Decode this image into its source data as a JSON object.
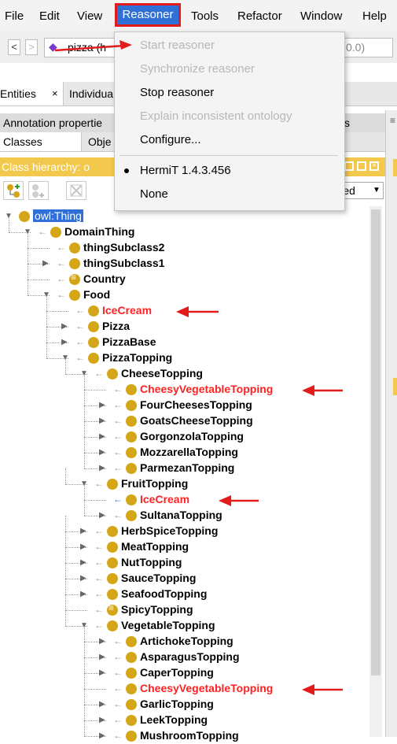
{
  "menubar": {
    "items": [
      "File",
      "Edit",
      "View",
      "Reasoner",
      "Tools",
      "Refactor",
      "Window",
      "Help"
    ]
  },
  "toolbar": {
    "back": "<",
    "forward": ">",
    "address_text": "pizza (h",
    "address_tail": "0.0)"
  },
  "tabs": {
    "row1": [
      "Entities",
      "Individua"
    ],
    "row1_close": "×",
    "row2": [
      "Annotation propertie",
      "s"
    ],
    "row3": [
      "Classes",
      "Obje"
    ]
  },
  "hierarchy": {
    "title": "Class hierarchy: o",
    "sort_label": "erted"
  },
  "reasoner_menu": {
    "items": [
      {
        "label": "Start reasoner",
        "enabled": false
      },
      {
        "label": "Synchronize reasoner",
        "enabled": false
      },
      {
        "label": "Stop reasoner",
        "enabled": true
      },
      {
        "label": "Explain inconsistent ontology",
        "enabled": false
      },
      {
        "label": "Configure...",
        "enabled": true
      },
      {
        "label": "HermiT 1.4.3.456",
        "enabled": true,
        "selected": true
      },
      {
        "label": "None",
        "enabled": true
      }
    ]
  },
  "tree": [
    {
      "label": "owl:Thing",
      "depth": 0,
      "toggle": "open",
      "selected": true
    },
    {
      "label": "DomainThing",
      "depth": 1,
      "toggle": "open"
    },
    {
      "label": "thingSubclass2",
      "depth": 2,
      "toggle": "none"
    },
    {
      "label": "thingSubclass1",
      "depth": 2,
      "toggle": "closed"
    },
    {
      "label": "Country",
      "depth": 2,
      "toggle": "none",
      "defined": true
    },
    {
      "label": "Food",
      "depth": 2,
      "toggle": "open"
    },
    {
      "label": "IceCream",
      "depth": 3,
      "toggle": "none",
      "red": true
    },
    {
      "label": "Pizza",
      "depth": 3,
      "toggle": "closed"
    },
    {
      "label": "PizzaBase",
      "depth": 3,
      "toggle": "closed"
    },
    {
      "label": "PizzaTopping",
      "depth": 3,
      "toggle": "open"
    },
    {
      "label": "CheeseTopping",
      "depth": 4,
      "toggle": "open"
    },
    {
      "label": "CheesyVegetableTopping",
      "depth": 5,
      "toggle": "none",
      "red": true
    },
    {
      "label": "FourCheesesTopping",
      "depth": 5,
      "toggle": "closed"
    },
    {
      "label": "GoatsCheeseTopping",
      "depth": 5,
      "toggle": "closed"
    },
    {
      "label": "GorgonzolaTopping",
      "depth": 5,
      "toggle": "closed"
    },
    {
      "label": "MozzarellaTopping",
      "depth": 5,
      "toggle": "closed"
    },
    {
      "label": "ParmezanTopping",
      "depth": 5,
      "toggle": "closed"
    },
    {
      "label": "FruitTopping",
      "depth": 4,
      "toggle": "open"
    },
    {
      "label": "IceCream",
      "depth": 5,
      "toggle": "none",
      "red": true,
      "inferred": true
    },
    {
      "label": "SultanaTopping",
      "depth": 5,
      "toggle": "closed"
    },
    {
      "label": "HerbSpiceTopping",
      "depth": 4,
      "toggle": "closed"
    },
    {
      "label": "MeatTopping",
      "depth": 4,
      "toggle": "closed"
    },
    {
      "label": "NutTopping",
      "depth": 4,
      "toggle": "closed"
    },
    {
      "label": "SauceTopping",
      "depth": 4,
      "toggle": "closed"
    },
    {
      "label": "SeafoodTopping",
      "depth": 4,
      "toggle": "closed"
    },
    {
      "label": "SpicyTopping",
      "depth": 4,
      "toggle": "none",
      "defined": true
    },
    {
      "label": "VegetableTopping",
      "depth": 4,
      "toggle": "open"
    },
    {
      "label": "ArtichokeTopping",
      "depth": 5,
      "toggle": "closed"
    },
    {
      "label": "AsparagusTopping",
      "depth": 5,
      "toggle": "closed"
    },
    {
      "label": "CaperTopping",
      "depth": 5,
      "toggle": "closed"
    },
    {
      "label": "CheesyVegetableTopping",
      "depth": 5,
      "toggle": "none",
      "red": true
    },
    {
      "label": "GarlicTopping",
      "depth": 5,
      "toggle": "closed"
    },
    {
      "label": "LeekTopping",
      "depth": 5,
      "toggle": "closed"
    },
    {
      "label": "MushroomTopping",
      "depth": 5,
      "toggle": "closed"
    }
  ],
  "colors": {
    "accent": "#2f6fd8",
    "annotation_red": "#e21b1b",
    "class_dot": "#d4a516",
    "header_yellow": "#f2c94c"
  }
}
